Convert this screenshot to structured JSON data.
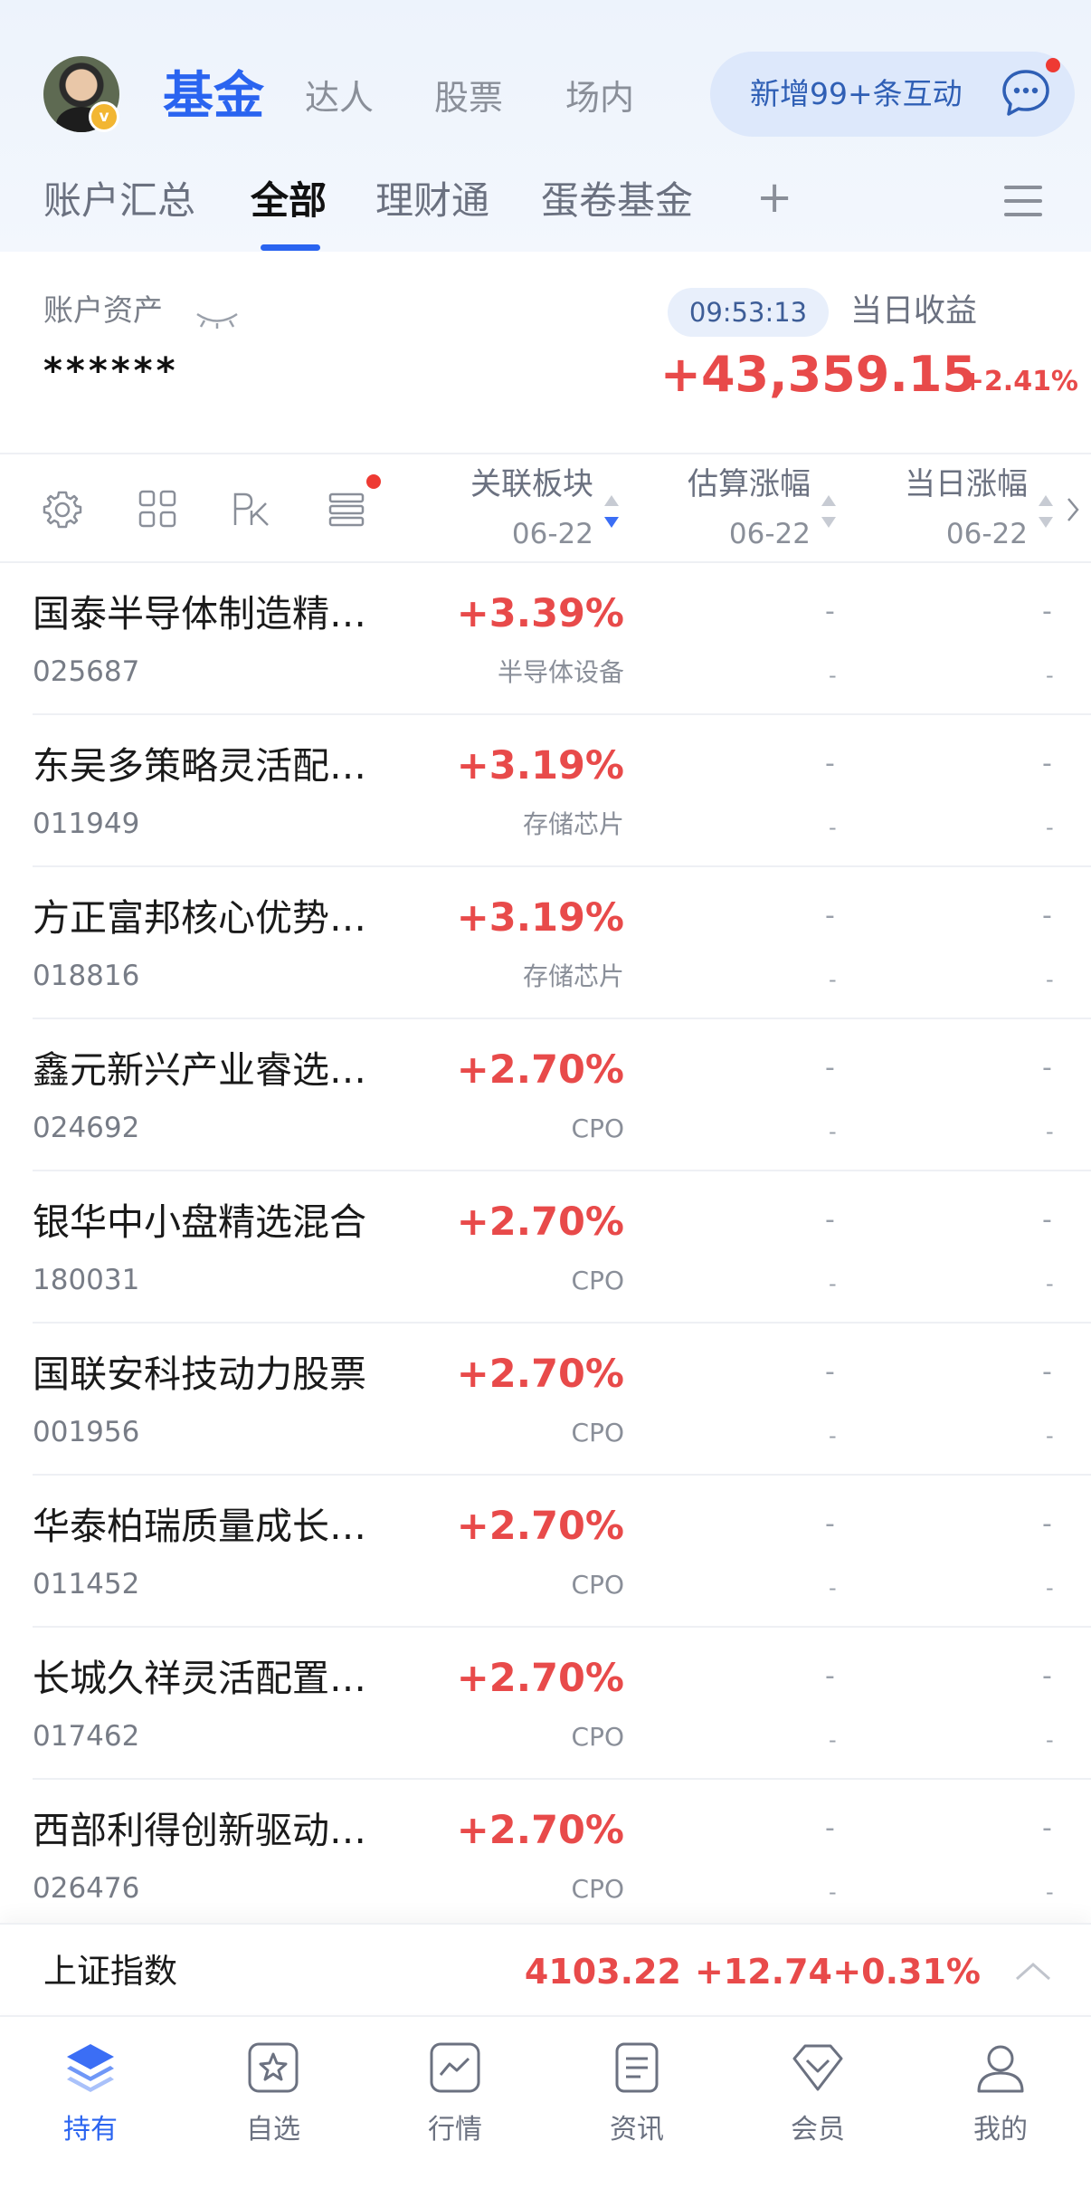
{
  "header": {
    "main_tabs": [
      "基金",
      "达人",
      "股票",
      "场内"
    ],
    "interaction_pill": "新增99+条互动",
    "sub_tabs": [
      "账户汇总",
      "全部",
      "理财通",
      "蛋卷基金"
    ],
    "add": "+"
  },
  "summary": {
    "asset_label": "账户资产",
    "asset_masked": "******",
    "time": "09:53:13",
    "daily_label": "当日收益",
    "daily_value": "+43,359.15",
    "daily_pct": "+2.41%"
  },
  "table": {
    "columns": [
      {
        "label": "关联板块",
        "date": "06-22"
      },
      {
        "label": "估算涨幅",
        "date": "06-22"
      },
      {
        "label": "当日涨幅",
        "date": "06-22"
      }
    ],
    "rows": [
      {
        "name": "国泰半导体制造精…",
        "code": "025687",
        "pct": "+3.39%",
        "sector": "半导体设备",
        "est": "-",
        "est_sub": "-",
        "day": "-",
        "day_sub": "-"
      },
      {
        "name": "东吴多策略灵活配…",
        "code": "011949",
        "pct": "+3.19%",
        "sector": "存储芯片",
        "est": "-",
        "est_sub": "-",
        "day": "-",
        "day_sub": "-"
      },
      {
        "name": "方正富邦核心优势…",
        "code": "018816",
        "pct": "+3.19%",
        "sector": "存储芯片",
        "est": "-",
        "est_sub": "-",
        "day": "-",
        "day_sub": "-"
      },
      {
        "name": "鑫元新兴产业睿选…",
        "code": "024692",
        "pct": "+2.70%",
        "sector": "CPO",
        "est": "-",
        "est_sub": "-",
        "day": "-",
        "day_sub": "-"
      },
      {
        "name": "银华中小盘精选混合",
        "code": "180031",
        "pct": "+2.70%",
        "sector": "CPO",
        "est": "-",
        "est_sub": "-",
        "day": "-",
        "day_sub": "-"
      },
      {
        "name": "国联安科技动力股票",
        "code": "001956",
        "pct": "+2.70%",
        "sector": "CPO",
        "est": "-",
        "est_sub": "-",
        "day": "-",
        "day_sub": "-"
      },
      {
        "name": "华泰柏瑞质量成长…",
        "code": "011452",
        "pct": "+2.70%",
        "sector": "CPO",
        "est": "-",
        "est_sub": "-",
        "day": "-",
        "day_sub": "-"
      },
      {
        "name": "长城久祥灵活配置…",
        "code": "017462",
        "pct": "+2.70%",
        "sector": "CPO",
        "est": "-",
        "est_sub": "-",
        "day": "-",
        "day_sub": "-"
      },
      {
        "name": "西部利得创新驱动…",
        "code": "026476",
        "pct": "+2.70%",
        "sector": "CPO",
        "est": "-",
        "est_sub": "-",
        "day": "-",
        "day_sub": "-"
      }
    ]
  },
  "ticker": {
    "name": "上证指数",
    "value": "4103.22",
    "change": "+12.74",
    "pct": "+0.31%"
  },
  "nav": [
    {
      "label": "持有",
      "icon": "layers-icon"
    },
    {
      "label": "自选",
      "icon": "star-icon"
    },
    {
      "label": "行情",
      "icon": "chart-icon"
    },
    {
      "label": "资讯",
      "icon": "news-icon"
    },
    {
      "label": "会员",
      "icon": "diamond-icon"
    },
    {
      "label": "我的",
      "icon": "user-icon"
    }
  ],
  "colors": {
    "brand": "#2a64f0",
    "up": "#e84a4a",
    "muted": "#8a8f99"
  }
}
